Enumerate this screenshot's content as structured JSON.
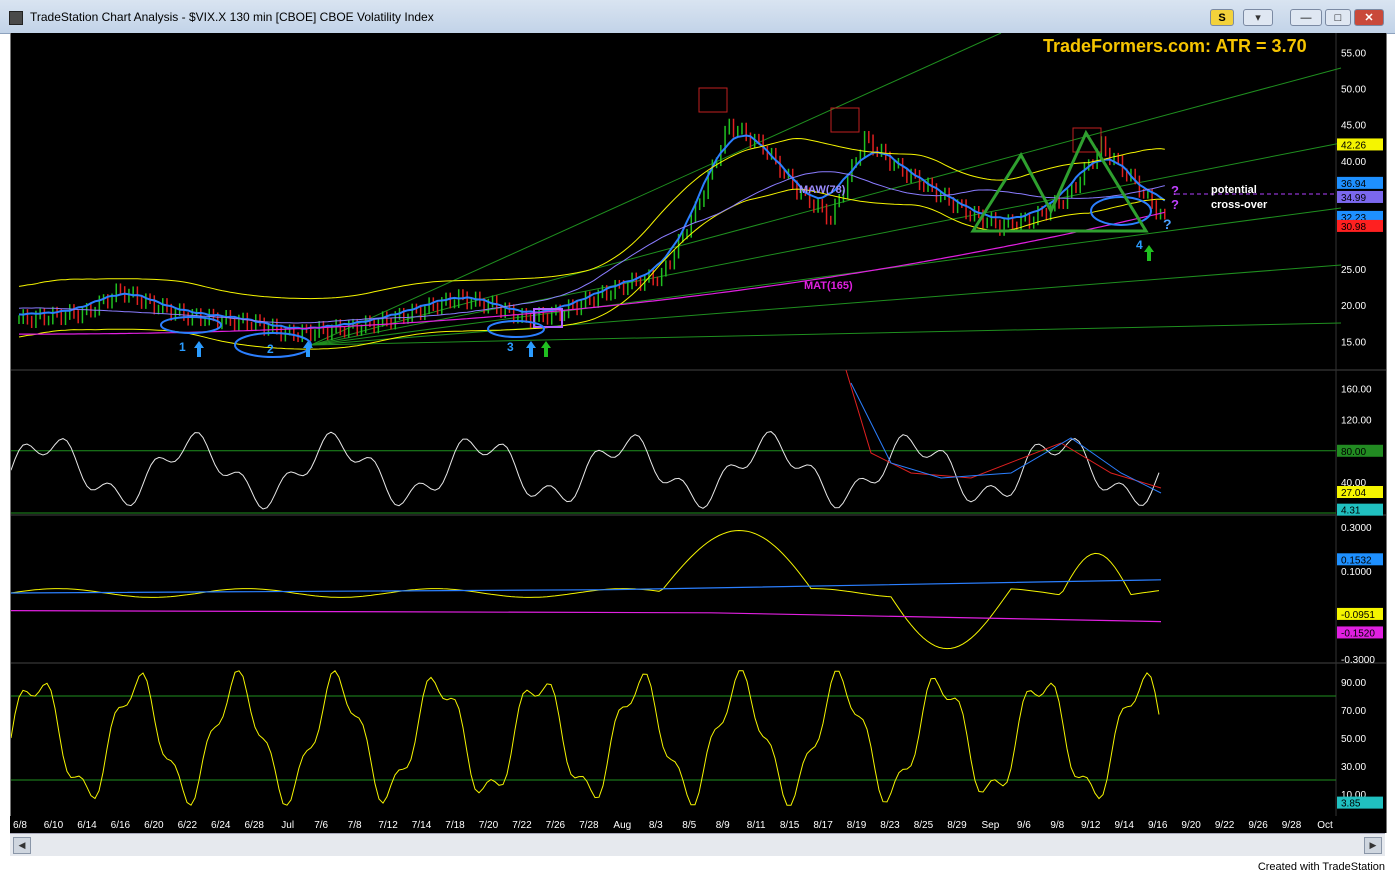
{
  "window": {
    "title": "TradeStation Chart Analysis - $VIX.X 130 min [CBOE] CBOE Volatility Index",
    "s_button": "S",
    "t_button": "▾",
    "min_button": "—",
    "max_button": "□",
    "close_button": "✕"
  },
  "header": {
    "brand": "TradeFormers.com:  ATR  = 3.70"
  },
  "annotations": {
    "maw": "MAW(78)",
    "mat": "MAT(165)",
    "potential": "potential",
    "crossover": "cross-over",
    "labels": [
      "1",
      "2",
      "3",
      "4"
    ],
    "q": "?"
  },
  "price_axis": {
    "ticks": [
      "55.00",
      "50.00",
      "45.00",
      "40.00",
      "25.00",
      "20.00",
      "15.00"
    ],
    "badges": [
      {
        "text": "42.26",
        "color": "#f5f500",
        "fg": "#000"
      },
      {
        "text": "36.94",
        "color": "#1e90ff",
        "fg": "#000"
      },
      {
        "text": "34.99",
        "color": "#7b68ee",
        "fg": "#000"
      },
      {
        "text": "32.23",
        "color": "#1e90ff",
        "fg": "#000"
      },
      {
        "text": "30.98",
        "color": "#ff2020",
        "fg": "#000"
      }
    ]
  },
  "osc1_axis": {
    "ticks": [
      "160.00",
      "120.00",
      "40.00"
    ],
    "badges": [
      {
        "text": "80.00",
        "color": "#228b22",
        "fg": "#000"
      },
      {
        "text": "27.04",
        "color": "#f5f500",
        "fg": "#000"
      },
      {
        "text": "4.31",
        "color": "#20c0c0",
        "fg": "#000"
      }
    ]
  },
  "osc2_axis": {
    "ticks": [
      "0.3000",
      "0.1000",
      "-0.3000"
    ],
    "badges": [
      {
        "text": "0.1532",
        "color": "#1e90ff",
        "fg": "#000"
      },
      {
        "text": "-0.0951",
        "color": "#f5f500",
        "fg": "#000"
      },
      {
        "text": "-0.1520",
        "color": "#e020e0",
        "fg": "#000"
      }
    ]
  },
  "osc3_axis": {
    "ticks": [
      "90.00",
      "70.00",
      "50.00",
      "30.00",
      "10.00"
    ],
    "badges": [
      {
        "text": "3.85",
        "color": "#20c0c0",
        "fg": "#000"
      }
    ]
  },
  "dates": [
    "6/8",
    "6/10",
    "6/14",
    "6/16",
    "6/20",
    "6/22",
    "6/24",
    "6/28",
    "Jul",
    "7/6",
    "7/8",
    "7/12",
    "7/14",
    "7/18",
    "7/20",
    "7/22",
    "7/26",
    "7/28",
    "Aug",
    "8/3",
    "8/5",
    "8/9",
    "8/11",
    "8/15",
    "8/17",
    "8/19",
    "8/23",
    "8/25",
    "8/29",
    "Sep",
    "9/6",
    "9/8",
    "9/12",
    "9/14",
    "9/16",
    "9/20",
    "9/22",
    "9/26",
    "9/28",
    "Oct"
  ],
  "footer": "Created with TradeStation",
  "colors": {
    "price_blue": "#2b7fff",
    "yellow": "#f5f500",
    "magenta": "#e020e0",
    "green_line": "#1f8f1f",
    "red_bar": "#e02020",
    "green_bar": "#20c020"
  },
  "chart_data": {
    "type": "line",
    "title": "$VIX.X 130 min [CBOE] CBOE Volatility Index",
    "x": [
      "6/8",
      "6/10",
      "6/14",
      "6/16",
      "6/20",
      "6/22",
      "6/24",
      "6/28",
      "Jul",
      "7/6",
      "7/8",
      "7/12",
      "7/14",
      "7/18",
      "7/20",
      "7/22",
      "7/26",
      "7/28",
      "Aug",
      "8/3",
      "8/5",
      "8/9",
      "8/11",
      "8/15",
      "8/17",
      "8/19",
      "8/23",
      "8/25",
      "8/29",
      "Sep",
      "9/6",
      "9/8",
      "9/12",
      "9/14",
      "9/16"
    ],
    "series": [
      {
        "values": [
          18,
          18.5,
          19,
          22,
          20,
          18.5,
          18,
          17.5,
          16,
          16.5,
          17,
          18,
          19.5,
          21,
          20,
          18,
          19,
          21,
          23,
          24,
          33,
          45,
          42,
          36,
          32,
          43,
          39,
          36,
          33,
          31,
          32,
          35,
          42,
          37,
          31
        ]
      }
    ],
    "ylim": [
      12,
      57
    ]
  }
}
